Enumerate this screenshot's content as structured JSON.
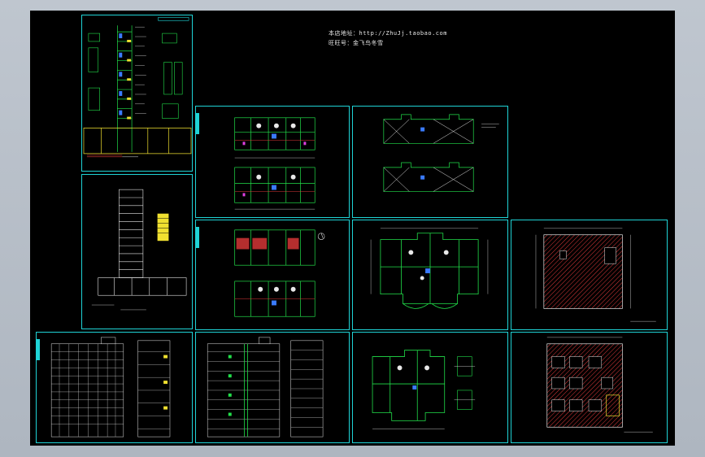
{
  "header": {
    "line1": "本店地址：http://ZhuJj.taobao.com",
    "line2": "旺旺号：金飞鸟冬雪"
  },
  "colors": {
    "background": "#b4bcc6",
    "model_space": "#000000",
    "frame": "#1fd3d6",
    "green": "#22e04a",
    "yellow": "#f0e030",
    "red": "#e23a3a",
    "white": "#e8e8e8",
    "magenta": "#e040e0",
    "blue": "#3a7bff"
  },
  "sheets": [
    {
      "id": "wall-section",
      "icon": "wall-section-detail-icon"
    },
    {
      "id": "floor-plan-pair-1",
      "icon": "floor-plan-icon"
    },
    {
      "id": "roof-plan-pair",
      "icon": "roof-plan-icon"
    },
    {
      "id": "building-section",
      "icon": "building-section-icon"
    },
    {
      "id": "floor-plan-pair-2",
      "icon": "floor-plan-icon"
    },
    {
      "id": "unit-plan",
      "icon": "unit-plan-icon"
    },
    {
      "id": "basement-plan",
      "icon": "basement-plan-icon"
    },
    {
      "id": "elevation-1",
      "icon": "elevation-icon"
    },
    {
      "id": "elevation-2",
      "icon": "elevation-icon"
    },
    {
      "id": "unit-plan-detail",
      "icon": "unit-plan-icon"
    },
    {
      "id": "ground-floor-plan",
      "icon": "ground-floor-plan-icon"
    }
  ]
}
